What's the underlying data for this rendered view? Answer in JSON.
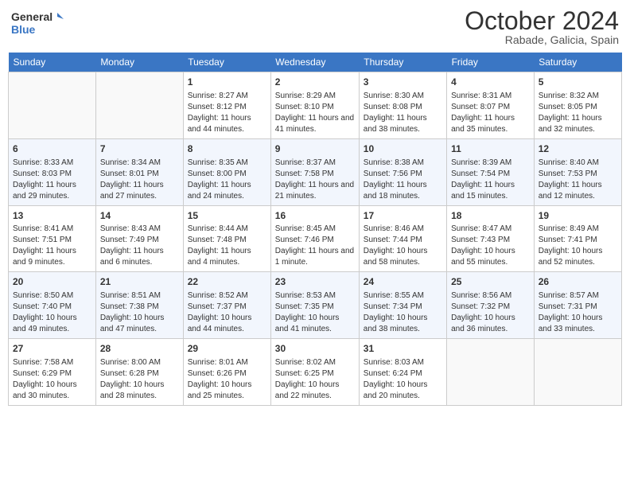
{
  "header": {
    "logo_line1": "General",
    "logo_line2": "Blue",
    "month": "October 2024",
    "location": "Rabade, Galicia, Spain"
  },
  "weekdays": [
    "Sunday",
    "Monday",
    "Tuesday",
    "Wednesday",
    "Thursday",
    "Friday",
    "Saturday"
  ],
  "weeks": [
    [
      {
        "day": "",
        "info": ""
      },
      {
        "day": "",
        "info": ""
      },
      {
        "day": "1",
        "info": "Sunrise: 8:27 AM\nSunset: 8:12 PM\nDaylight: 11 hours and 44 minutes."
      },
      {
        "day": "2",
        "info": "Sunrise: 8:29 AM\nSunset: 8:10 PM\nDaylight: 11 hours and 41 minutes."
      },
      {
        "day": "3",
        "info": "Sunrise: 8:30 AM\nSunset: 8:08 PM\nDaylight: 11 hours and 38 minutes."
      },
      {
        "day": "4",
        "info": "Sunrise: 8:31 AM\nSunset: 8:07 PM\nDaylight: 11 hours and 35 minutes."
      },
      {
        "day": "5",
        "info": "Sunrise: 8:32 AM\nSunset: 8:05 PM\nDaylight: 11 hours and 32 minutes."
      }
    ],
    [
      {
        "day": "6",
        "info": "Sunrise: 8:33 AM\nSunset: 8:03 PM\nDaylight: 11 hours and 29 minutes."
      },
      {
        "day": "7",
        "info": "Sunrise: 8:34 AM\nSunset: 8:01 PM\nDaylight: 11 hours and 27 minutes."
      },
      {
        "day": "8",
        "info": "Sunrise: 8:35 AM\nSunset: 8:00 PM\nDaylight: 11 hours and 24 minutes."
      },
      {
        "day": "9",
        "info": "Sunrise: 8:37 AM\nSunset: 7:58 PM\nDaylight: 11 hours and 21 minutes."
      },
      {
        "day": "10",
        "info": "Sunrise: 8:38 AM\nSunset: 7:56 PM\nDaylight: 11 hours and 18 minutes."
      },
      {
        "day": "11",
        "info": "Sunrise: 8:39 AM\nSunset: 7:54 PM\nDaylight: 11 hours and 15 minutes."
      },
      {
        "day": "12",
        "info": "Sunrise: 8:40 AM\nSunset: 7:53 PM\nDaylight: 11 hours and 12 minutes."
      }
    ],
    [
      {
        "day": "13",
        "info": "Sunrise: 8:41 AM\nSunset: 7:51 PM\nDaylight: 11 hours and 9 minutes."
      },
      {
        "day": "14",
        "info": "Sunrise: 8:43 AM\nSunset: 7:49 PM\nDaylight: 11 hours and 6 minutes."
      },
      {
        "day": "15",
        "info": "Sunrise: 8:44 AM\nSunset: 7:48 PM\nDaylight: 11 hours and 4 minutes."
      },
      {
        "day": "16",
        "info": "Sunrise: 8:45 AM\nSunset: 7:46 PM\nDaylight: 11 hours and 1 minute."
      },
      {
        "day": "17",
        "info": "Sunrise: 8:46 AM\nSunset: 7:44 PM\nDaylight: 10 hours and 58 minutes."
      },
      {
        "day": "18",
        "info": "Sunrise: 8:47 AM\nSunset: 7:43 PM\nDaylight: 10 hours and 55 minutes."
      },
      {
        "day": "19",
        "info": "Sunrise: 8:49 AM\nSunset: 7:41 PM\nDaylight: 10 hours and 52 minutes."
      }
    ],
    [
      {
        "day": "20",
        "info": "Sunrise: 8:50 AM\nSunset: 7:40 PM\nDaylight: 10 hours and 49 minutes."
      },
      {
        "day": "21",
        "info": "Sunrise: 8:51 AM\nSunset: 7:38 PM\nDaylight: 10 hours and 47 minutes."
      },
      {
        "day": "22",
        "info": "Sunrise: 8:52 AM\nSunset: 7:37 PM\nDaylight: 10 hours and 44 minutes."
      },
      {
        "day": "23",
        "info": "Sunrise: 8:53 AM\nSunset: 7:35 PM\nDaylight: 10 hours and 41 minutes."
      },
      {
        "day": "24",
        "info": "Sunrise: 8:55 AM\nSunset: 7:34 PM\nDaylight: 10 hours and 38 minutes."
      },
      {
        "day": "25",
        "info": "Sunrise: 8:56 AM\nSunset: 7:32 PM\nDaylight: 10 hours and 36 minutes."
      },
      {
        "day": "26",
        "info": "Sunrise: 8:57 AM\nSunset: 7:31 PM\nDaylight: 10 hours and 33 minutes."
      }
    ],
    [
      {
        "day": "27",
        "info": "Sunrise: 7:58 AM\nSunset: 6:29 PM\nDaylight: 10 hours and 30 minutes."
      },
      {
        "day": "28",
        "info": "Sunrise: 8:00 AM\nSunset: 6:28 PM\nDaylight: 10 hours and 28 minutes."
      },
      {
        "day": "29",
        "info": "Sunrise: 8:01 AM\nSunset: 6:26 PM\nDaylight: 10 hours and 25 minutes."
      },
      {
        "day": "30",
        "info": "Sunrise: 8:02 AM\nSunset: 6:25 PM\nDaylight: 10 hours and 22 minutes."
      },
      {
        "day": "31",
        "info": "Sunrise: 8:03 AM\nSunset: 6:24 PM\nDaylight: 10 hours and 20 minutes."
      },
      {
        "day": "",
        "info": ""
      },
      {
        "day": "",
        "info": ""
      }
    ]
  ]
}
